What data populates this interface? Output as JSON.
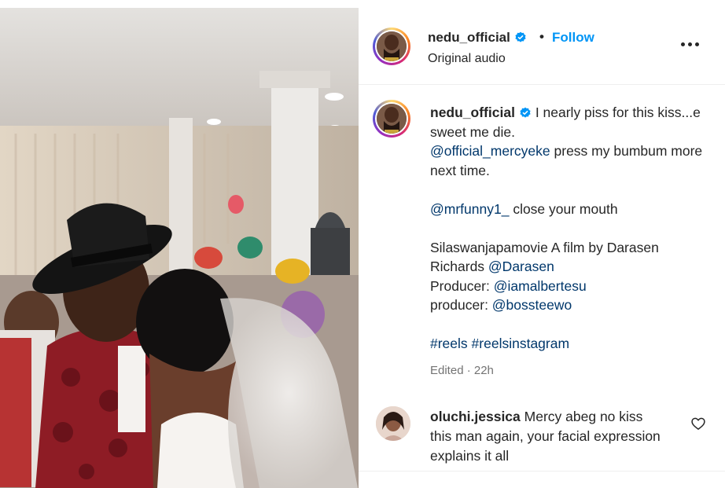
{
  "post": {
    "username": "nedu_official",
    "dot": "•",
    "follow_label": "Follow",
    "audio": "Original audio",
    "more_icon": "more-horizontal-icon",
    "verified_icon": "verified-badge-icon",
    "verified_color": "#0095f6"
  },
  "caption": {
    "username": "nedu_official",
    "text_1": "I nearly piss for this kiss...e sweet me die.",
    "mention_1": "@official_mercyeke",
    "text_2": " press my bumbum more next time.",
    "mention_2": "@mrfunny1_",
    "text_3": " close your mouth",
    "text_4": "Silaswanjapamovie A film by Darasen Richards ",
    "mention_3": "@Darasen",
    "producer_1_label": "Producer: ",
    "mention_4": "@iamalbertesu",
    "producer_2_label": "producer: ",
    "mention_5": "@bossteewo",
    "hashtag_1": "#reels",
    "hashtag_2": "#reelsinstagram",
    "meta": "Edited · 22h"
  },
  "comment": {
    "username": "oluchi.jessica",
    "text": "Mercy abeg no kiss this man again, your facial expression explains it all",
    "heart_icon": "heart-outline-icon"
  },
  "colors": {
    "link": "#00376b",
    "follow": "#0095f6",
    "muted": "#737373"
  }
}
